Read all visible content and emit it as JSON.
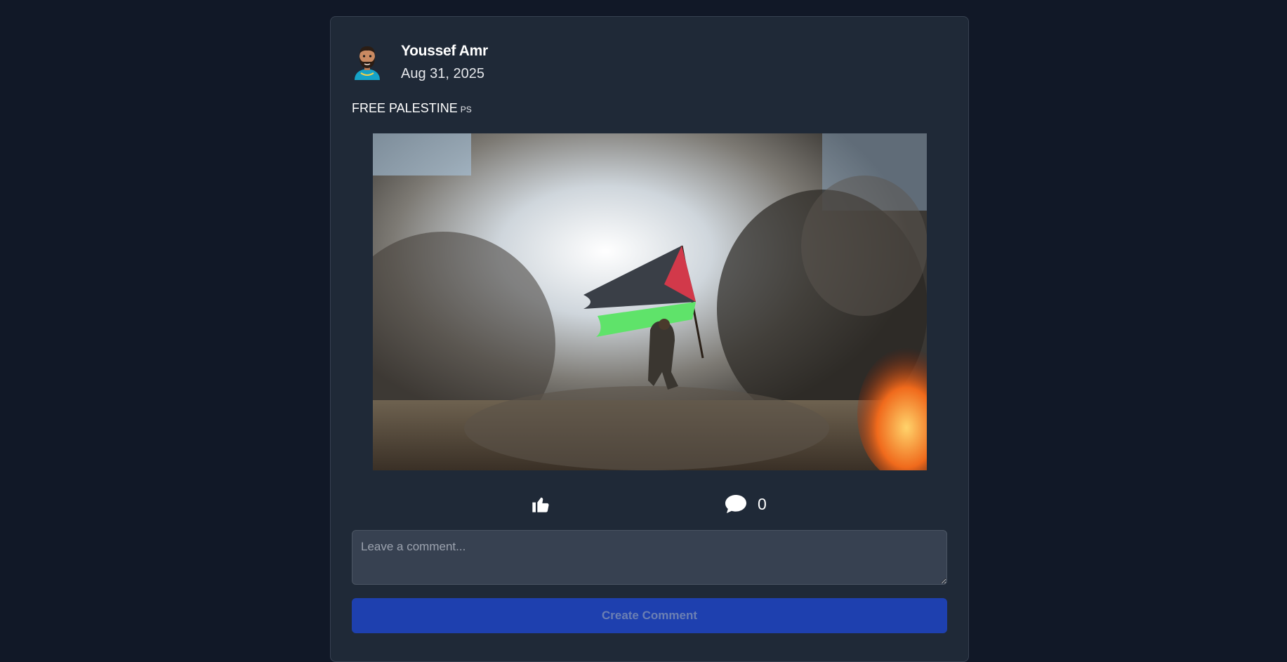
{
  "post": {
    "author": "Youssef Amr",
    "date": "Aug 31, 2025",
    "text": "FREE PALESTINE",
    "flag_code": "PS",
    "image_icon": "photo-flag-smoke",
    "avatar_icon": "memoji-avatar"
  },
  "actions": {
    "like_icon": "thumbs-up-icon",
    "comment_icon": "comment-bubble-icon",
    "comment_count": "0"
  },
  "comment_form": {
    "placeholder": "Leave a comment...",
    "value": "",
    "submit_label": "Create Comment"
  },
  "colors": {
    "page_bg": "#111827",
    "card_bg": "#1f2937",
    "input_bg": "#374151",
    "button_bg": "#1e40af"
  }
}
